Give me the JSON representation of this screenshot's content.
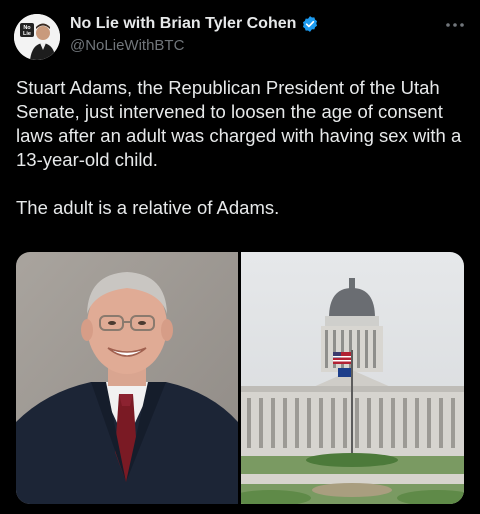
{
  "tweet": {
    "display_name": "No Lie with Brian Tyler Cohen",
    "handle": "@NoLieWithBTC",
    "avatar_logo_text": "No Lie",
    "paragraphs": [
      "Stuart Adams, the Republican President of the Utah Senate, just intervened to loosen the age of consent laws after an adult was charged with having sex with a 13-year-old child.",
      "The adult is a relative of Adams."
    ]
  },
  "colors": {
    "background": "#000000",
    "text": "#e7e9ea",
    "secondary_text": "#71767b",
    "verified_badge": "#1d9bf0"
  },
  "icons": {
    "verified": "verified-badge-icon",
    "more": "more-options-icon"
  },
  "media": {
    "left_image": "portrait-photo",
    "right_image": "capitol-building-photo"
  }
}
